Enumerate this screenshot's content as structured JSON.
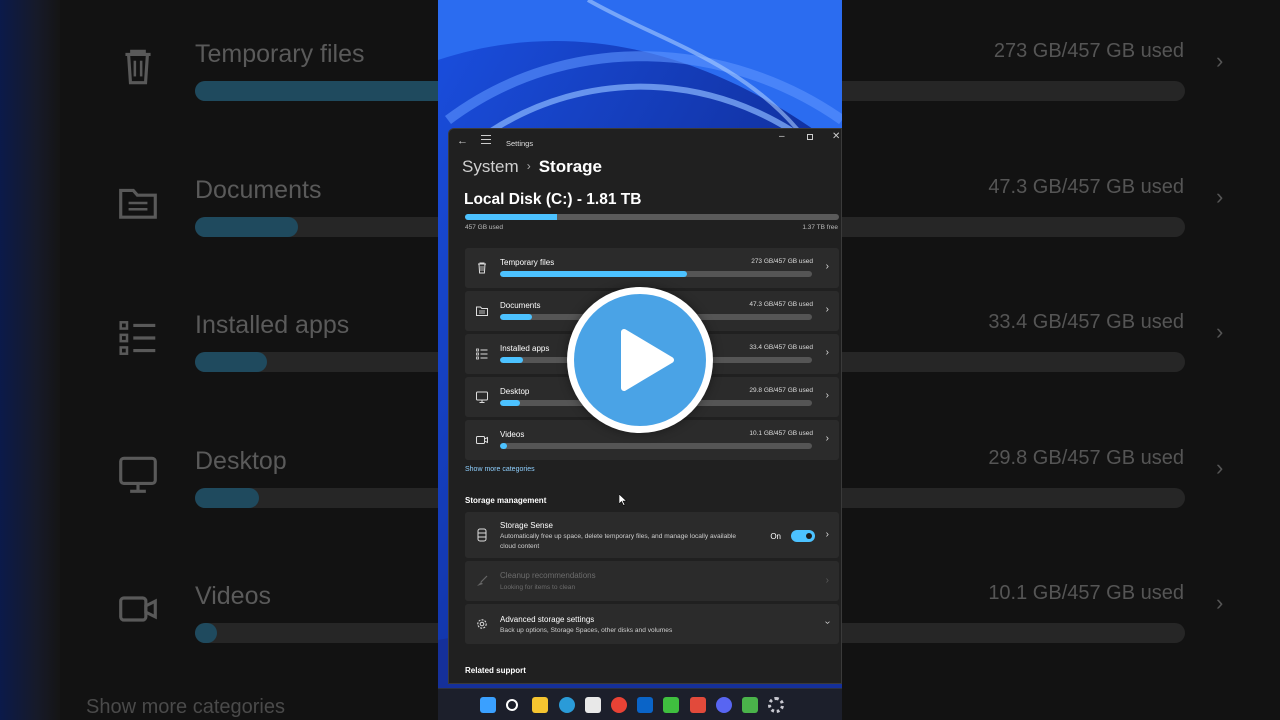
{
  "background": {
    "rows": [
      {
        "icon": "trash-icon",
        "label": "Temporary files",
        "used": "273 GB/457 GB used",
        "fill": 0.6
      },
      {
        "icon": "folder-icon",
        "label": "Documents",
        "used": "47.3 GB/457 GB used",
        "fill": 0.104
      },
      {
        "icon": "list-icon",
        "label": "Installed apps",
        "used": "33.4 GB/457 GB used",
        "fill": 0.073
      },
      {
        "icon": "monitor-icon",
        "label": "Desktop",
        "used": "29.8 GB/457 GB used",
        "fill": 0.065
      },
      {
        "icon": "video-icon",
        "label": "Videos",
        "used": "10.1 GB/457 GB used",
        "fill": 0.022
      }
    ],
    "more": "Show more categories"
  },
  "window": {
    "title": "Settings",
    "breadcrumb": {
      "parent": "System",
      "separator": "›",
      "current": "Storage"
    },
    "disk": {
      "title": "Local Disk (C:) - 1.81 TB",
      "used": "457 GB used",
      "free": "1.37 TB free",
      "fill": 0.247
    },
    "categories": [
      {
        "icon": "trash-icon",
        "label": "Temporary files",
        "used": "273 GB/457 GB used",
        "fill": 0.6
      },
      {
        "icon": "folder-icon",
        "label": "Documents",
        "used": "47.3 GB/457 GB used",
        "fill": 0.104
      },
      {
        "icon": "list-icon",
        "label": "Installed apps",
        "used": "33.4 GB/457 GB used",
        "fill": 0.073
      },
      {
        "icon": "monitor-icon",
        "label": "Desktop",
        "used": "29.8 GB/457 GB used",
        "fill": 0.065
      },
      {
        "icon": "video-icon",
        "label": "Videos",
        "used": "10.1 GB/457 GB used",
        "fill": 0.022
      }
    ],
    "show_more": "Show more categories",
    "storage_management": {
      "heading": "Storage management",
      "sense": {
        "title": "Storage Sense",
        "desc": "Automatically free up space, delete temporary files, and manage locally available cloud content",
        "toggle": "On"
      },
      "cleanup": {
        "title": "Cleanup recommendations",
        "desc": "Looking for items to clean"
      },
      "advanced": {
        "title": "Advanced storage settings",
        "desc": "Back up options, Storage Spaces, other disks and volumes"
      }
    },
    "related": "Related support"
  },
  "taskbar": {
    "items": [
      "windows-start-icon",
      "search-icon",
      "file-explorer-icon",
      "edge-icon",
      "store-icon",
      "chrome-icon",
      "outlook-icon",
      "app-green-icon",
      "app-red-icon",
      "discord-icon",
      "lock-app-icon",
      "settings-icon"
    ]
  },
  "colors": {
    "accent": "#4cc2ff",
    "window_bg": "#202020",
    "card_bg": "#2b2b2b",
    "play": "#4aa3e6"
  }
}
